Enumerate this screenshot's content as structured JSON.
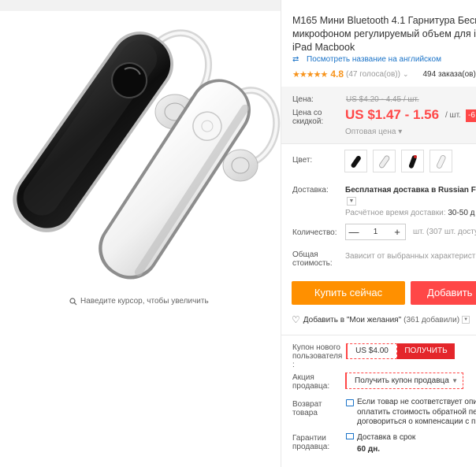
{
  "product": {
    "title_lines": [
      "M165 Мини Bluetooth 4.1 Гарнитура Бесп",
      "микрофоном регулируемый объем для iP",
      "iPad Macbook"
    ],
    "translate_link": "Посмотреть название на английском",
    "rating": {
      "stars": "★★★★★",
      "value": "4.8",
      "votes": "(47 голоса(ов))",
      "orders": "494 заказа(ов)"
    }
  },
  "image": {
    "zoom_hint": "Наведите курсор, чтобы увеличить"
  },
  "price": {
    "label": "Цена:",
    "original": "US $4.20 - 4.45 / шт.",
    "discount_label": "Цена со скидкой:",
    "current": "US $1.47 - 1.56",
    "unit": "/ шт.",
    "discount": "-6",
    "wholesale": "Оптовая цена ▾"
  },
  "color": {
    "label": "Цвет:",
    "options": [
      "black",
      "white",
      "black-red",
      "white-silver"
    ]
  },
  "shipping": {
    "label": "Доставка:",
    "text_prefix": "Бесплатная доставка в",
    "text_dest": "Russian Fed",
    "delivery_label": "Расчётное время доставки:",
    "delivery_value": "30-50 д"
  },
  "quantity": {
    "label": "Количество:",
    "minus": "—",
    "value": "1",
    "plus": "+",
    "note": "шт. (307 шт. досту"
  },
  "total": {
    "label": "Общая стоимость:",
    "note": "Зависит от выбранных характеристи"
  },
  "actions": {
    "buy_now": "Купить сейчас",
    "add_to_cart": "Добавить",
    "wishlist": "Добавить в \"Мои желания\"",
    "wishlist_count": "(361 добавили)"
  },
  "coupons": {
    "new_user_label": "Купон нового пользователя :",
    "new_user_value": "US $4.00",
    "get": "ПОЛУЧИТЬ",
    "seller_label": "Акция продавца:",
    "seller_button": "Получить купон продавца"
  },
  "returns": {
    "label": "Возврат товара",
    "lines": [
      "Если товар не соответствует опи",
      "оплатить стоимость обратной пер",
      "договориться о компенсации с п"
    ]
  },
  "guarantee": {
    "label": "Гарантии продавца:",
    "text": "Доставка в срок",
    "days": "60 дн."
  },
  "colors": {
    "accent_orange": "#ff9000",
    "accent_red": "#ff4747",
    "link_blue": "#1a73c8",
    "star": "#f7941d"
  }
}
